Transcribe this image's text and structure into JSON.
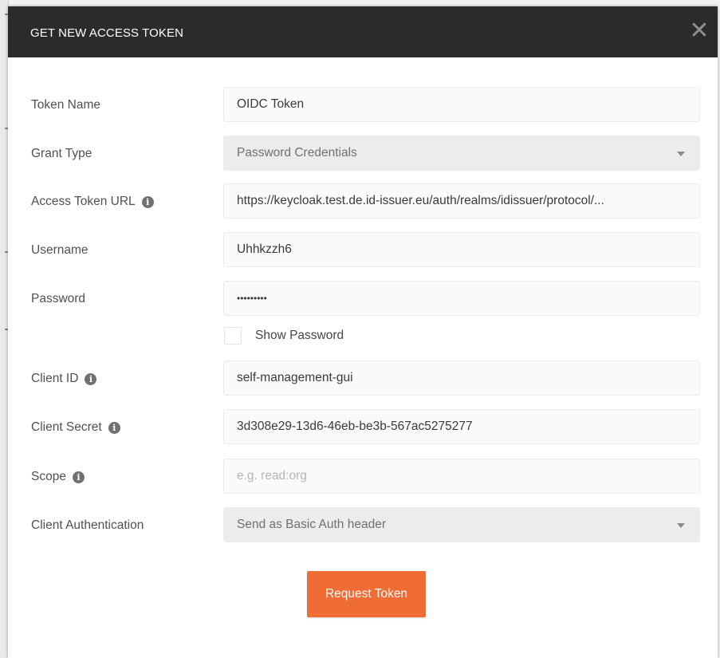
{
  "dialog": {
    "title": "GET NEW ACCESS TOKEN",
    "close_glyph": "✕"
  },
  "fields": {
    "token_name": {
      "label": "Token Name",
      "value": "OIDC Token"
    },
    "grant_type": {
      "label": "Grant Type",
      "value": "Password Credentials"
    },
    "access_token_url": {
      "label": "Access Token URL",
      "value": "https://keycloak.test.de.id-issuer.eu/auth/realms/idissuer/protocol/..."
    },
    "username": {
      "label": "Username",
      "value": "Uhhkzzh6"
    },
    "password": {
      "label": "Password",
      "value": "•••••••••"
    },
    "show_password": {
      "label": "Show Password",
      "checked": false
    },
    "client_id": {
      "label": "Client ID",
      "value": "self-management-gui"
    },
    "client_secret": {
      "label": "Client Secret",
      "value": "3d308e29-13d6-46eb-be3b-567ac5275277"
    },
    "scope": {
      "label": "Scope",
      "placeholder": "e.g. read:org",
      "value": ""
    },
    "client_authentication": {
      "label": "Client Authentication",
      "value": "Send as Basic Auth header"
    }
  },
  "actions": {
    "request_token": "Request Token"
  },
  "icons": {
    "info": "info-icon",
    "close": "close-icon",
    "dropdown": "chevron-down-icon"
  },
  "colors": {
    "header_bg": "#2b2b2b",
    "accent": "#ef6c35",
    "field_bg": "#fafafa",
    "select_bg": "#ececec"
  }
}
